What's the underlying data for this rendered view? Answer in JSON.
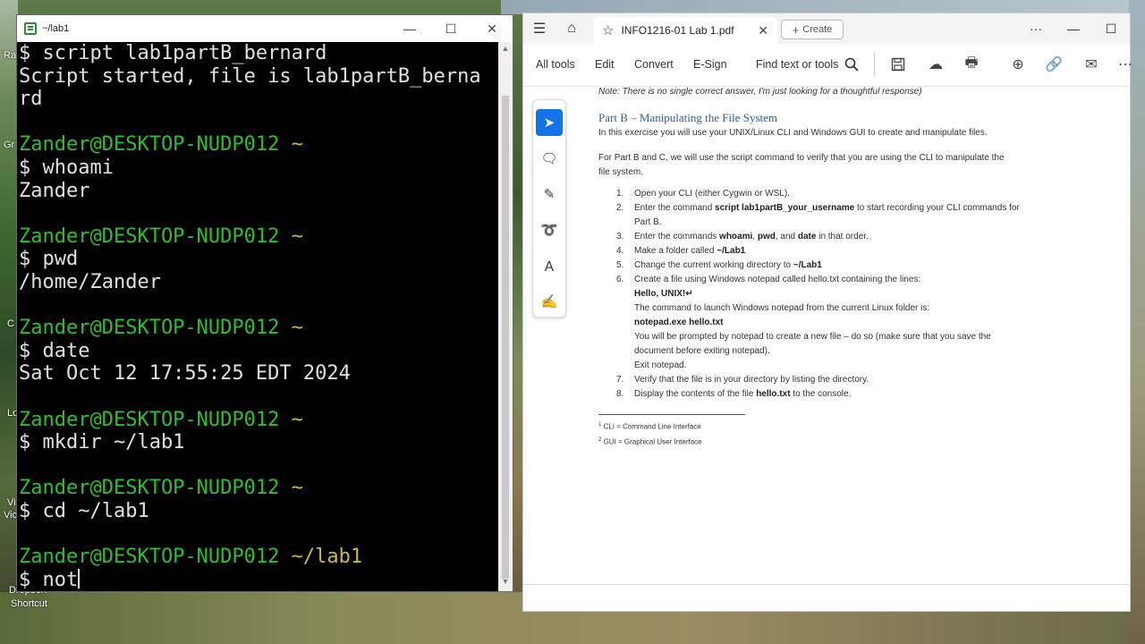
{
  "desktop": {
    "labels": [
      "Ra",
      "Gr",
      "C",
      "Lo",
      "Vi",
      "Vic",
      "Dropbox",
      "Shortcut"
    ]
  },
  "terminal": {
    "title": "~/lab1",
    "minimize": "—",
    "maximize": "☐",
    "close": "✕",
    "lines": [
      {
        "type": "cmd",
        "text": "$ script lab1partB_bernard"
      },
      {
        "type": "out",
        "text": "Script started, file is lab1partB_berna"
      },
      {
        "type": "out",
        "text": "rd"
      },
      {
        "type": "blank",
        "text": ""
      },
      {
        "type": "prompt",
        "user": "Zander@DESKTOP-NUDP012",
        "path": " ~"
      },
      {
        "type": "cmd",
        "text": "$ whoami"
      },
      {
        "type": "out",
        "text": "Zander"
      },
      {
        "type": "blank",
        "text": ""
      },
      {
        "type": "prompt",
        "user": "Zander@DESKTOP-NUDP012",
        "path": " ~"
      },
      {
        "type": "cmd",
        "text": "$ pwd"
      },
      {
        "type": "out",
        "text": "/home/Zander"
      },
      {
        "type": "blank",
        "text": ""
      },
      {
        "type": "prompt",
        "user": "Zander@DESKTOP-NUDP012",
        "path": " ~"
      },
      {
        "type": "cmd",
        "text": "$ date"
      },
      {
        "type": "out",
        "text": "Sat Oct 12 17:55:25 EDT 2024"
      },
      {
        "type": "blank",
        "text": ""
      },
      {
        "type": "prompt",
        "user": "Zander@DESKTOP-NUDP012",
        "path": " ~"
      },
      {
        "type": "cmd",
        "text": "$ mkdir ~/lab1"
      },
      {
        "type": "blank",
        "text": ""
      },
      {
        "type": "prompt",
        "user": "Zander@DESKTOP-NUDP012",
        "path": " ~"
      },
      {
        "type": "cmd",
        "text": "$ cd ~/lab1"
      },
      {
        "type": "blank",
        "text": ""
      },
      {
        "type": "prompt",
        "user": "Zander@DESKTOP-NUDP012",
        "path": " ~/lab1"
      },
      {
        "type": "input",
        "text": "$ not"
      }
    ]
  },
  "pdf": {
    "tab_title": "INFO1216-01 Lab 1.pdf",
    "create_label": "Create",
    "more": "···",
    "toolbar": {
      "all_tools": "All tools",
      "edit": "Edit",
      "convert": "Convert",
      "esign": "E-Sign",
      "find": "Find text or tools"
    },
    "doc": {
      "note": "Note: There is no single correct answer, I'm just looking for a thoughtful response)",
      "heading": "Part B – Manipulating the File System",
      "intro": "In this exercise you will use your UNIX/Linux CLI and Windows GUI to create and manipulate files.",
      "para2_a": "For Part B and C, we will use the script command to verify that you are using the CLI to manipulate the",
      "para2_b": "file system.",
      "steps": {
        "s1": "Open your CLI (either Cygwin or WSL).",
        "s2_a": "Enter the command ",
        "s2_b": "script lab1partB_your_username",
        "s2_c": " to start recording your CLI commands for",
        "s2_d": "Part B.",
        "s3_a": "Enter the commands ",
        "s3_b": "whoami",
        "s3_c": ", ",
        "s3_d": "pwd",
        "s3_e": ", and ",
        "s3_f": "date",
        "s3_g": " in that order.",
        "s4_a": "Make a folder called ",
        "s4_b": "~/Lab1",
        "s5_a": "Change the current working directory to ",
        "s5_b": "~/Lab1",
        "s6": "Create a file using Windows notepad called hello.txt containing the lines:",
        "s6_hello": "Hello, UNIX!↵",
        "s6_cmd_intro": "The command to launch Windows notepad from the current Linux folder is:",
        "s6_cmd": "notepad.exe hello.txt",
        "s6_prompt_a": "You will be prompted by notepad to create a new file – do so (make sure that you save the",
        "s6_prompt_b": "document before exiting notepad).",
        "s6_exit": "Exit notepad.",
        "s7": "Verify that the file is in your directory by listing the directory.",
        "s8_a": "Display the contents of the file ",
        "s8_b": "hello.txt",
        "s8_c": " to the console."
      },
      "nums": [
        "1.",
        "2.",
        "3.",
        "4.",
        "5.",
        "6.",
        "7.",
        "8."
      ],
      "footnote1": "CLI = Command Line Interface",
      "footnote2": "GUI = Graphical User Interface",
      "fn1_mark": "1",
      "fn2_mark": "2"
    }
  }
}
